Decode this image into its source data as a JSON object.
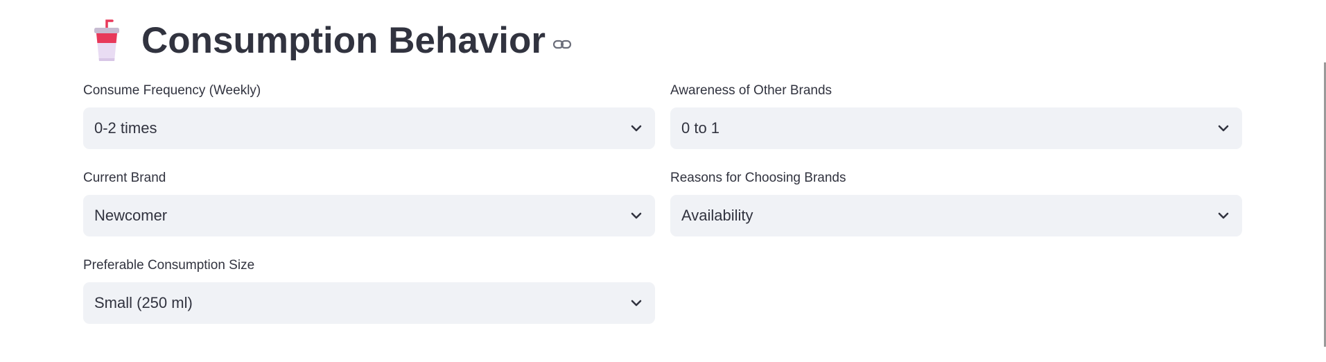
{
  "header": {
    "title": "Consumption Behavior",
    "icon": "cup-with-straw-icon"
  },
  "fields": {
    "consume_frequency": {
      "label": "Consume Frequency (Weekly)",
      "value": "0-2 times"
    },
    "awareness": {
      "label": "Awareness of Other Brands",
      "value": "0 to 1"
    },
    "current_brand": {
      "label": "Current Brand",
      "value": "Newcomer"
    },
    "reasons": {
      "label": "Reasons for Choosing Brands",
      "value": "Availability"
    },
    "consumption_size": {
      "label": "Preferable Consumption Size",
      "value": "Small (250 ml)"
    }
  },
  "colors": {
    "text": "#31333f",
    "select_bg": "#f0f2f6",
    "cup_red": "#e8395a",
    "cup_lavender": "#e6d6f2"
  }
}
